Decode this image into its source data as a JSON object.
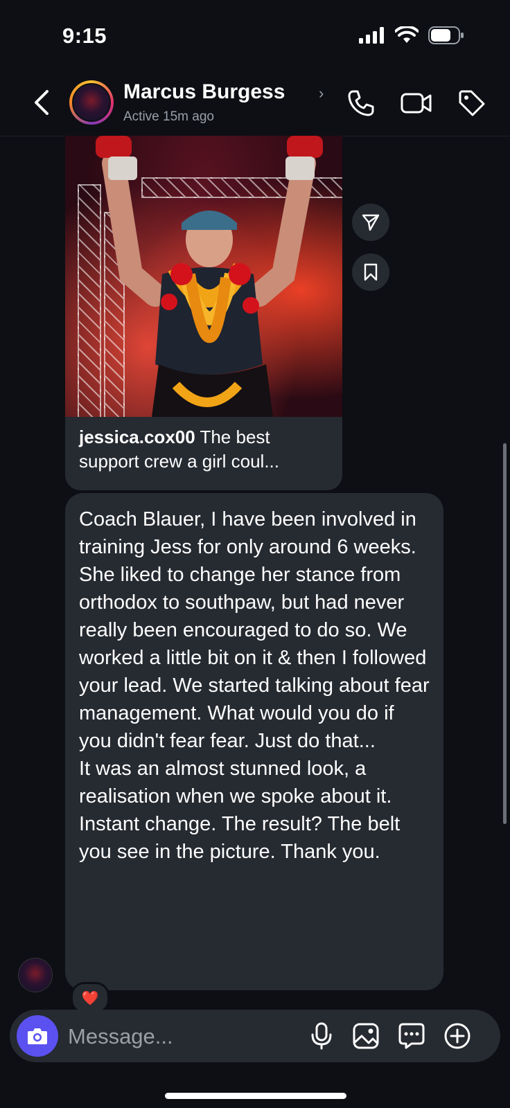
{
  "status_bar": {
    "time": "9:15",
    "icons": [
      "signal-icon",
      "wifi-icon",
      "battery-icon"
    ]
  },
  "header": {
    "contact_name": "Marcus Burgess",
    "name_chevron": "›",
    "status": "Active 15m ago",
    "icons": [
      "back-icon",
      "phone-icon",
      "video-icon",
      "tag-icon"
    ]
  },
  "shared_post": {
    "username": "jessica.cox00",
    "caption": " The best support crew a girl coul..."
  },
  "side_actions": [
    "share-icon",
    "bookmark-icon"
  ],
  "message": {
    "text": "Coach Blauer, I have been involved in training Jess for only around 6 weeks. She liked to change her stance from orthodox to southpaw, but had never really been encouraged to do so. We worked a little bit on it & then I followed your lead. We started talking about fear management. What would you do if you didn't fear fear. Just do that...\nIt was an almost stunned look, a realisation when we spoke about it. Instant change. The result? The belt you see in the picture. Thank you."
  },
  "reaction": {
    "emoji": "❤️"
  },
  "composer": {
    "placeholder": "Message...",
    "icons": [
      "camera-icon",
      "microphone-icon",
      "gallery-icon",
      "sticker-icon",
      "plus-icon"
    ]
  },
  "colors": {
    "background": "#0d0f14",
    "bubble": "#262a31",
    "accent": "#5b51f0",
    "muted_text": "#9aa0a8"
  }
}
